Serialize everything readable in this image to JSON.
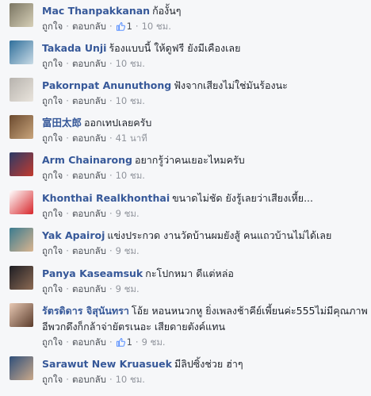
{
  "comments": [
    {
      "name": "Mac Thanpakkanan",
      "text": "ก้องั้นๆ",
      "like": "ถูกใจ",
      "reply": "ตอบกลับ",
      "likes": "1",
      "time": "10 ชม.",
      "colors": [
        "#7a7562",
        "#d7d0b8"
      ]
    },
    {
      "name": "Takada Unji",
      "text": "ร้องแบบนี้ ให้ดูฟรี ยังมีเคืองเลย",
      "like": "ถูกใจ",
      "reply": "ตอบกลับ",
      "likes": "",
      "time": "10 ชม.",
      "colors": [
        "#2f6f9b",
        "#c9dbe6"
      ]
    },
    {
      "name": "Pakornpat Anunuthong",
      "text": "ฟังจากเสียงไม่ใช่มันร้องนะ",
      "like": "ถูกใจ",
      "reply": "ตอบกลับ",
      "likes": "",
      "time": "10 ชม.",
      "colors": [
        "#b7b3ae",
        "#e9e4dc"
      ]
    },
    {
      "name": "富田太郎",
      "text": "ออกเทปเลยครับ",
      "like": "ถูกใจ",
      "reply": "ตอบกลับ",
      "likes": "",
      "time": "41 นาที",
      "colors": [
        "#6b4a2f",
        "#c9a57c"
      ]
    },
    {
      "name": "Arm Chainarong",
      "text": "อยากรู้ว่าคนเยอะไหมครับ",
      "like": "ถูกใจ",
      "reply": "ตอบกลับ",
      "likes": "",
      "time": "10 ชม.",
      "colors": [
        "#2b3a66",
        "#c23a2e"
      ]
    },
    {
      "name": "Khonthai Realkhonthai",
      "text": "ขนาดไม่ชัด ยังรู้เลยว่าเสียงเหี้ย...",
      "like": "ถูกใจ",
      "reply": "ตอบกลับ",
      "likes": "",
      "time": "9 ชม.",
      "colors": [
        "#ffffff",
        "#d7262b"
      ]
    },
    {
      "name": "Yak Apairoj",
      "text": "แข่งประกวด งานวัดบ้านผมยังสู้ คนแถวบ้านไม่ได้เลย",
      "like": "ถูกใจ",
      "reply": "ตอบกลับ",
      "likes": "",
      "time": "9 ชม.",
      "colors": [
        "#3b7b8f",
        "#d9b48f"
      ]
    },
    {
      "name": "Panya Kaseamsuk",
      "text": "กะโปกหมา ดีแต่หล่อ",
      "like": "ถูกใจ",
      "reply": "ตอบกลับ",
      "likes": "",
      "time": "9 ชม.",
      "colors": [
        "#1e1e24",
        "#8c6a53"
      ]
    },
    {
      "name": "รัตรดิดาร จิสุนันทรา",
      "text": "โอ้ย หอนหนวกหู ยิ่งเพลงช้าคีย์เพี้ยนค่ะ555ไม่มีคุณภาพ อีพวกดึงก็กล้าจ่ายัตรเนอะ เสียดายตังค์แทน",
      "like": "ถูกใจ",
      "reply": "ตอบกลับ",
      "likes": "1",
      "time": "9 ชม.",
      "colors": [
        "#e8c9b4",
        "#5a3b2b"
      ]
    },
    {
      "name": "Sarawut New Kruasuek",
      "text": "มีลิปซิ้งช่วย ฮ่าๆ",
      "like": "ถูกใจ",
      "reply": "ตอบกลับ",
      "likes": "",
      "time": "10 ชม.",
      "colors": [
        "#2f4f7a",
        "#caa98a"
      ]
    }
  ]
}
